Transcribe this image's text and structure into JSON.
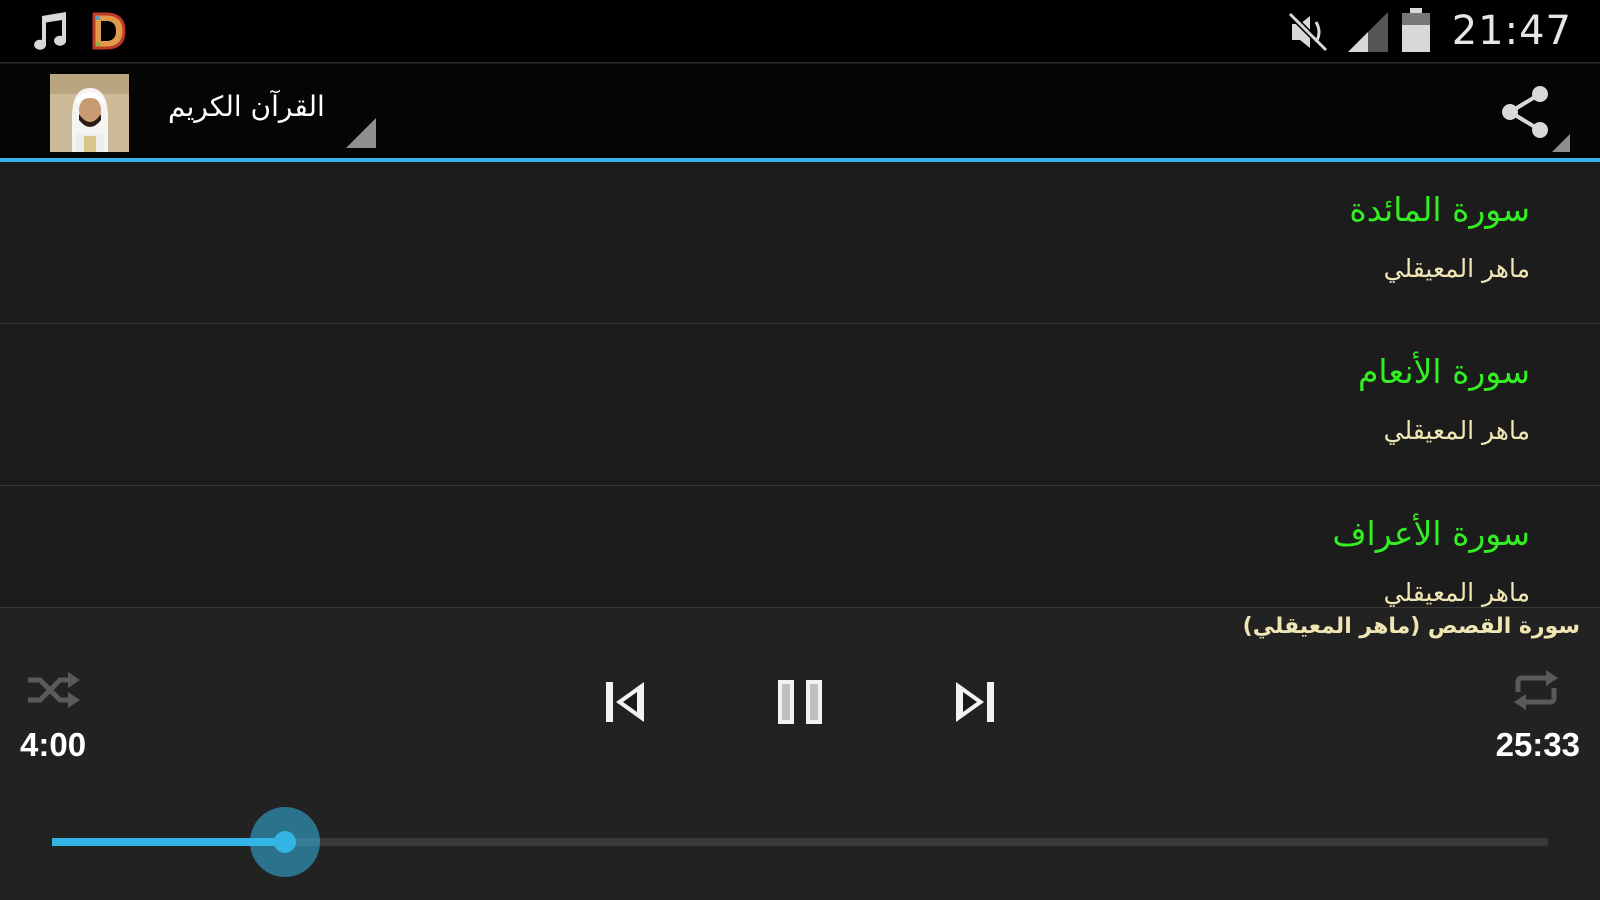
{
  "status_bar": {
    "time": "21:47",
    "icons": [
      "music-note-icon",
      "app-d-icon",
      "muted-icon",
      "signal-icon",
      "battery-icon"
    ]
  },
  "action_bar": {
    "title": "القرآن الكريم",
    "share_icon": "share-icon"
  },
  "list": {
    "items": [
      {
        "title": "سورة المائدة",
        "subtitle": "ماهر المعيقلي"
      },
      {
        "title": "سورة الأنعام",
        "subtitle": "ماهر المعيقلي"
      },
      {
        "title": "سورة الأعراف",
        "subtitle": "ماهر المعيقلي"
      }
    ]
  },
  "player": {
    "now_playing": "سورة القصص (ماهر المعيقلي)",
    "elapsed": "4:00",
    "duration": "25:33",
    "progress": 0.156,
    "controls": [
      "shuffle-icon",
      "previous-icon",
      "pause-icon",
      "next-icon",
      "repeat-icon"
    ]
  },
  "colors": {
    "accent": "#33b5e5",
    "title_green": "#33ee22",
    "subtitle_cream": "#f0e6b4"
  }
}
